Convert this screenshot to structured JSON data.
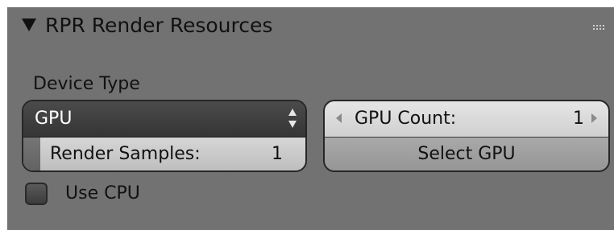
{
  "panel": {
    "title": "RPR Render Resources",
    "expanded": true,
    "background_color": "#727272",
    "collapse_icon": "triangle-down-icon",
    "grip_icon": "drag-grip-icon"
  },
  "device_type": {
    "label": "Device Type",
    "selected": "GPU",
    "icon": "updown-arrows-icon"
  },
  "render_samples": {
    "label": "Render Samples:",
    "value": "1",
    "fill_fraction": 0.06
  },
  "gpu_count": {
    "label": "GPU Count:",
    "value": "1",
    "left_icon": "arrow-left-icon",
    "right_icon": "arrow-right-icon"
  },
  "select_gpu": {
    "label": "Select GPU"
  },
  "use_cpu": {
    "label": "Use CPU",
    "checked": false
  }
}
